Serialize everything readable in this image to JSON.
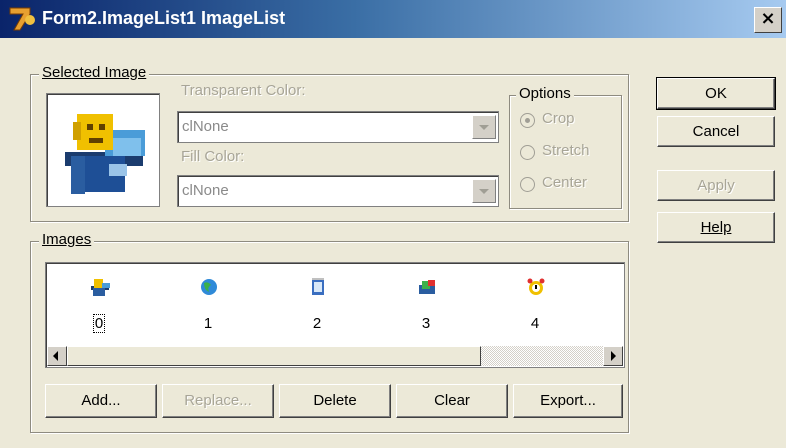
{
  "window": {
    "title": "Form2.ImageList1 ImageList",
    "close_label": "×",
    "icon": "delphi-app-icon"
  },
  "selected_image": {
    "legend": "Selected Image",
    "transparent_color_label": "Transparent Color:",
    "transparent_color_value": "clNone",
    "fill_color_label": "Fill Color:",
    "fill_color_value": "clNone"
  },
  "options": {
    "legend": "Options",
    "items": [
      {
        "label": "Crop",
        "checked": true
      },
      {
        "label": "Stretch",
        "checked": false
      },
      {
        "label": "Center",
        "checked": false
      }
    ]
  },
  "buttons": {
    "ok": "OK",
    "cancel": "Cancel",
    "apply": "Apply",
    "help": "Help"
  },
  "images": {
    "legend": "Images",
    "items": [
      {
        "caption": "0",
        "icon": "computer-network-icon"
      },
      {
        "caption": "1",
        "icon": "globe-icon"
      },
      {
        "caption": "2",
        "icon": "notepad-icon"
      },
      {
        "caption": "3",
        "icon": "bookmark-icon"
      },
      {
        "caption": "4",
        "icon": "alarm-clock-icon"
      }
    ],
    "scrollbar_position": 0.0
  },
  "actions": {
    "add": "Add...",
    "replace": "Replace...",
    "delete": "Delete",
    "clear": "Clear",
    "export": "Export..."
  }
}
